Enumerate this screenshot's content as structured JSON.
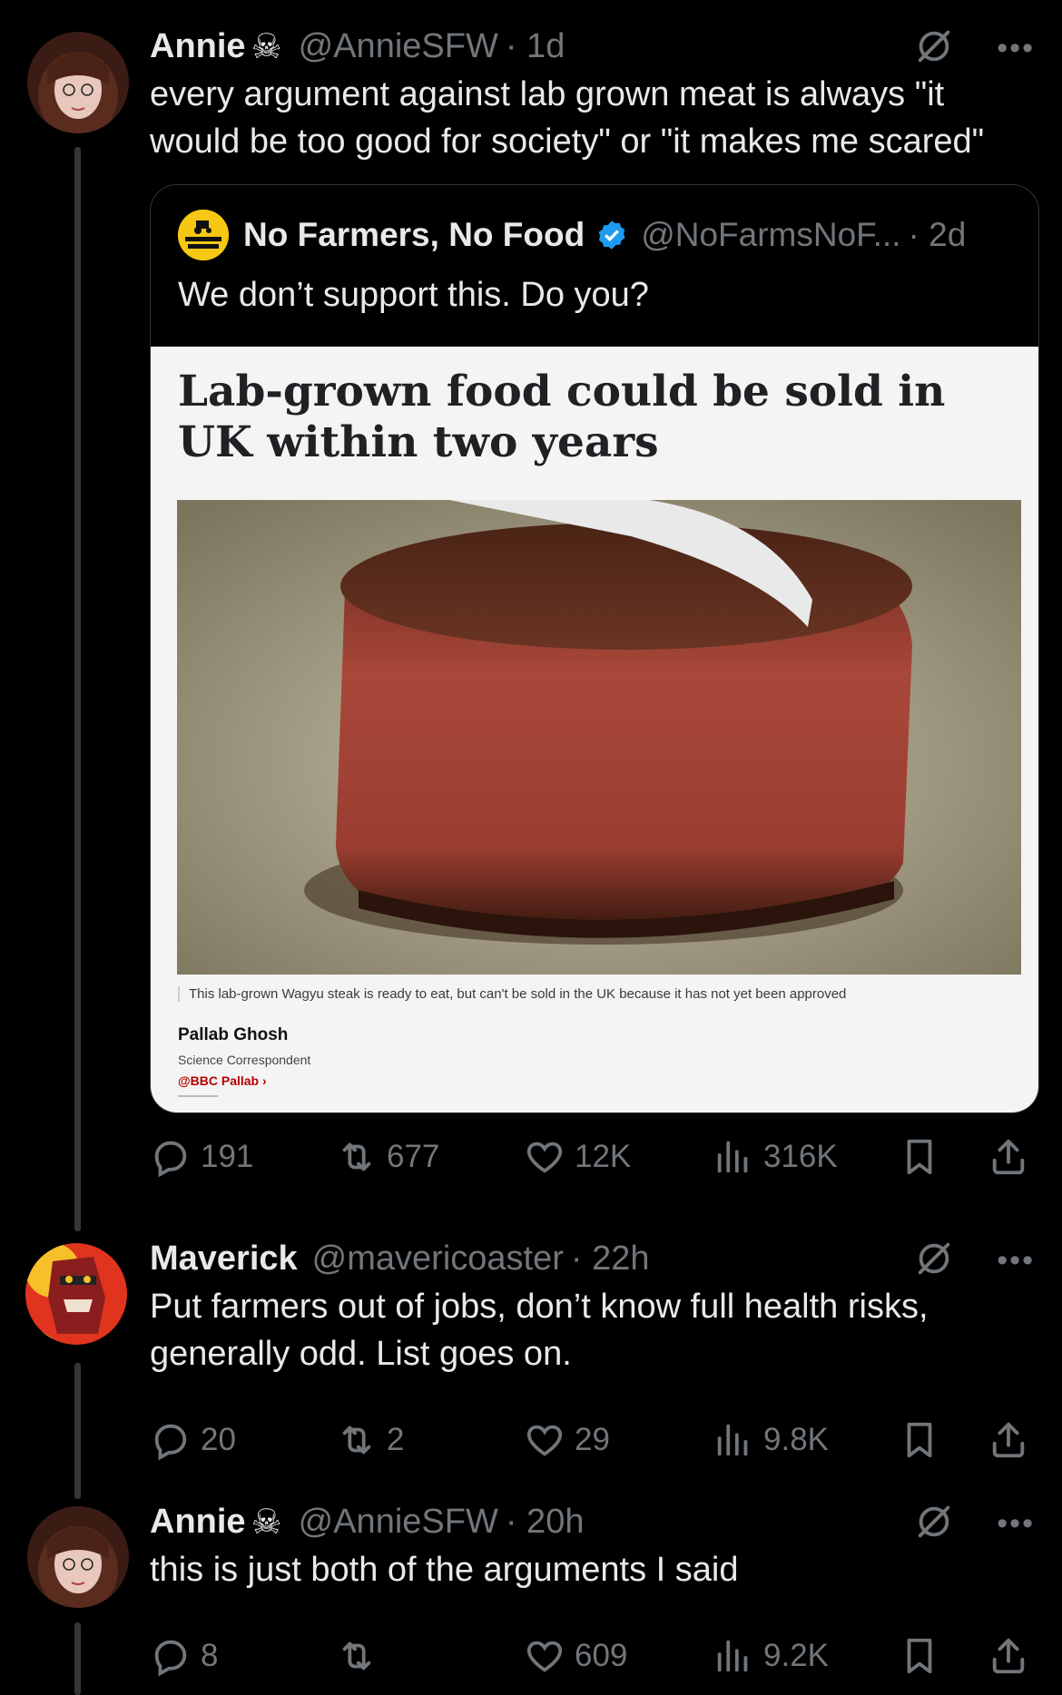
{
  "tweets": [
    {
      "name": "Annie",
      "name_emoji": "☠",
      "handle": "@AnnieSFW",
      "time": "· 1d",
      "text": "every argument against lab grown meat is always \"it would be too good for society\" or \"it makes me scared\"",
      "quote": {
        "logo_text": "NO FARMERS NO FOOD",
        "name": "No Farmers, No Food",
        "handle": "@NoFarmsNoF...",
        "time": "· 2d",
        "text": "We don’t support this. Do you?",
        "article": {
          "headline": "Lab-grown food could be sold in UK within two years",
          "caption": "This lab-grown Wagyu steak is ready to eat, but can't be sold in the UK because it has not yet been approved",
          "author": "Pallab Ghosh",
          "role": "Science Correspondent",
          "twitter": "@BBC Pallab ›"
        }
      },
      "stats": {
        "replies": "191",
        "reposts": "677",
        "likes": "12K",
        "views": "316K"
      }
    },
    {
      "name": "Maverick",
      "handle": "@mavericoaster",
      "time": "· 22h",
      "text": "Put farmers out of jobs, don’t know full health risks, generally odd. List goes on.",
      "stats": {
        "replies": "20",
        "reposts": "2",
        "likes": "29",
        "views": "9.8K"
      }
    },
    {
      "name": "Annie",
      "name_emoji": "☠",
      "handle": "@AnnieSFW",
      "time": "· 20h",
      "text": "this is just both of the arguments I said",
      "stats": {
        "replies": "8",
        "reposts": "",
        "likes": "609",
        "views": "9.2K"
      }
    }
  ],
  "more_label": "•••",
  "colors": {
    "background": "#000000",
    "text": "#e7e9ea",
    "muted": "#71767b",
    "verified": "#1d9bf0"
  }
}
